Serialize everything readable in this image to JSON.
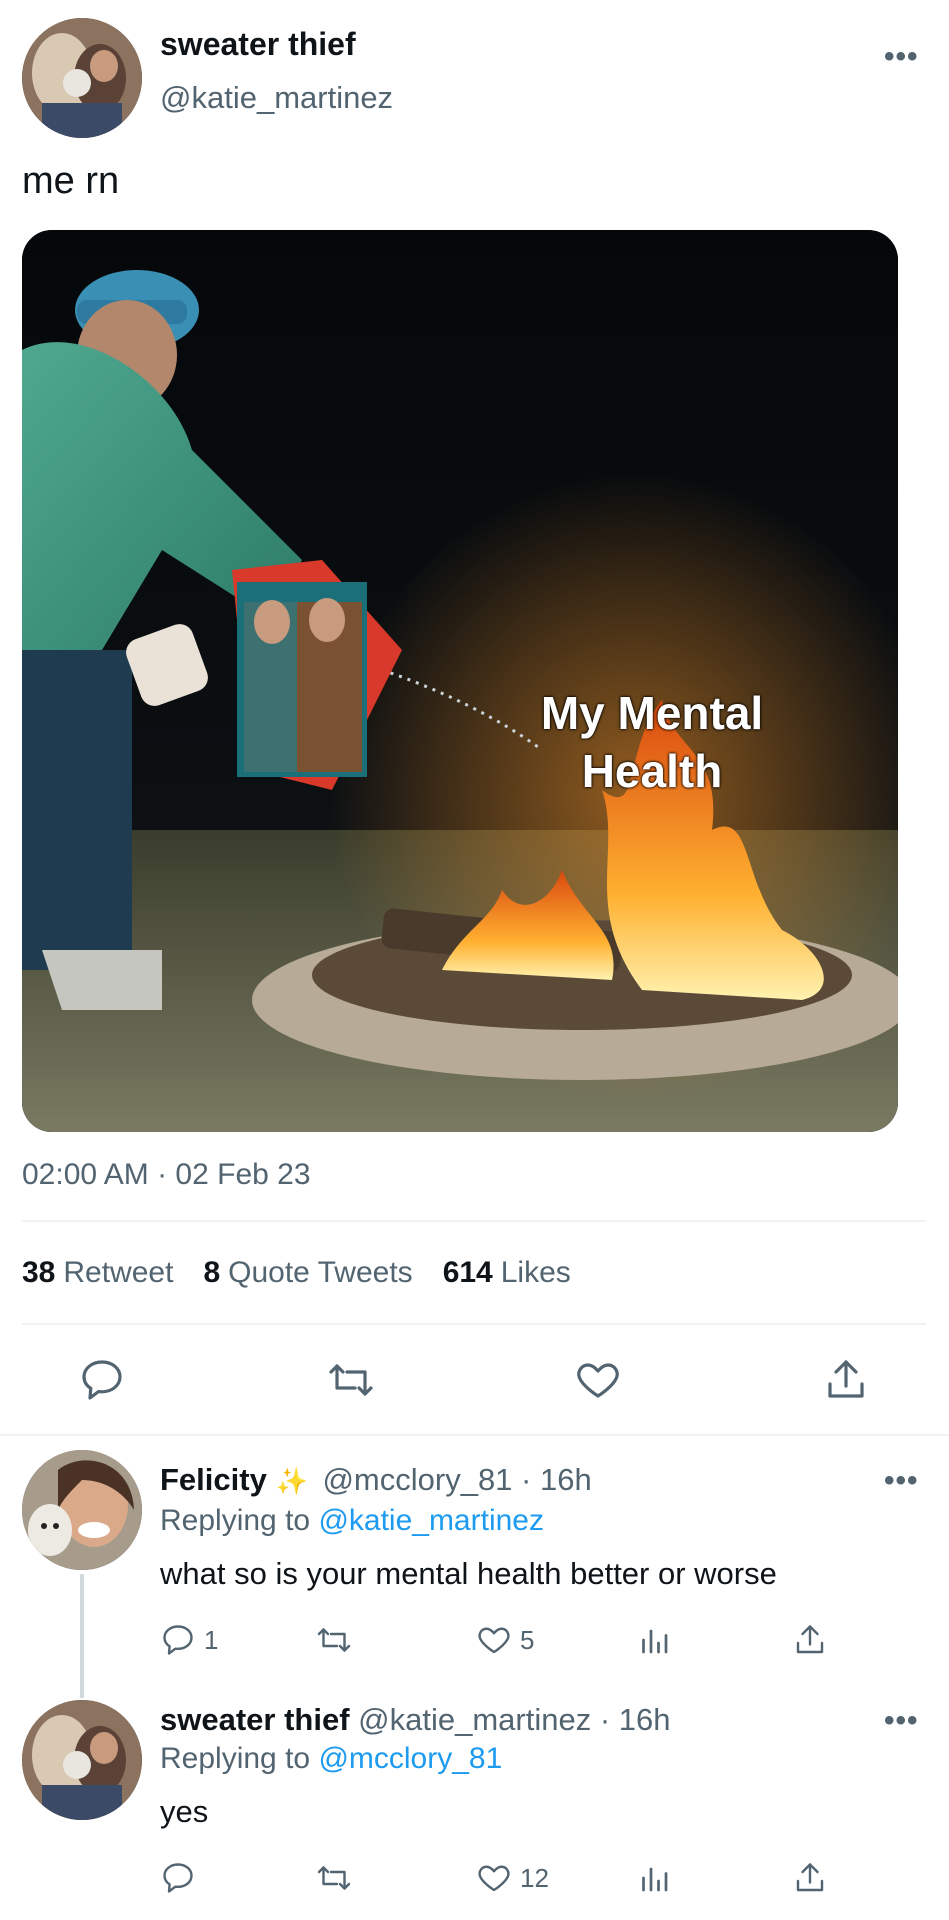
{
  "tweet": {
    "author_name": "sweater thief",
    "author_handle": "@katie_martinez",
    "text": "me rn",
    "meme_caption_line1": "My Mental",
    "meme_caption_line2": "Health",
    "timestamp": "02:00 AM · 02 Feb 23",
    "stats": {
      "retweets_count": "38",
      "retweets_label": "Retweet",
      "quotes_count": "8",
      "quotes_label": "Quote Tweets",
      "likes_count": "614",
      "likes_label": "Likes"
    },
    "actions": [
      "reply-icon",
      "retweet-icon",
      "like-icon",
      "share-icon"
    ]
  },
  "replies": [
    {
      "author_name": "Felicity",
      "badge": "✨",
      "author_handle": "@mcclory_81",
      "time": "· 16h",
      "replying_prefix": "Replying to",
      "replying_to": "@katie_martinez",
      "text": "what so is your mental health better or worse",
      "reply_count": "1",
      "retweet_count": "",
      "like_count": "5"
    },
    {
      "author_name": "sweater thief",
      "author_handle": "@katie_martinez",
      "time": "· 16h",
      "replying_prefix": "Replying to",
      "replying_to": "@mcclory_81",
      "text": "yes",
      "reply_count": "",
      "retweet_count": "",
      "like_count": "12"
    }
  ],
  "colors": {
    "text_primary": "#0f1419",
    "text_secondary": "#536471",
    "link": "#1d9bf0",
    "divider": "#eff3f4"
  }
}
